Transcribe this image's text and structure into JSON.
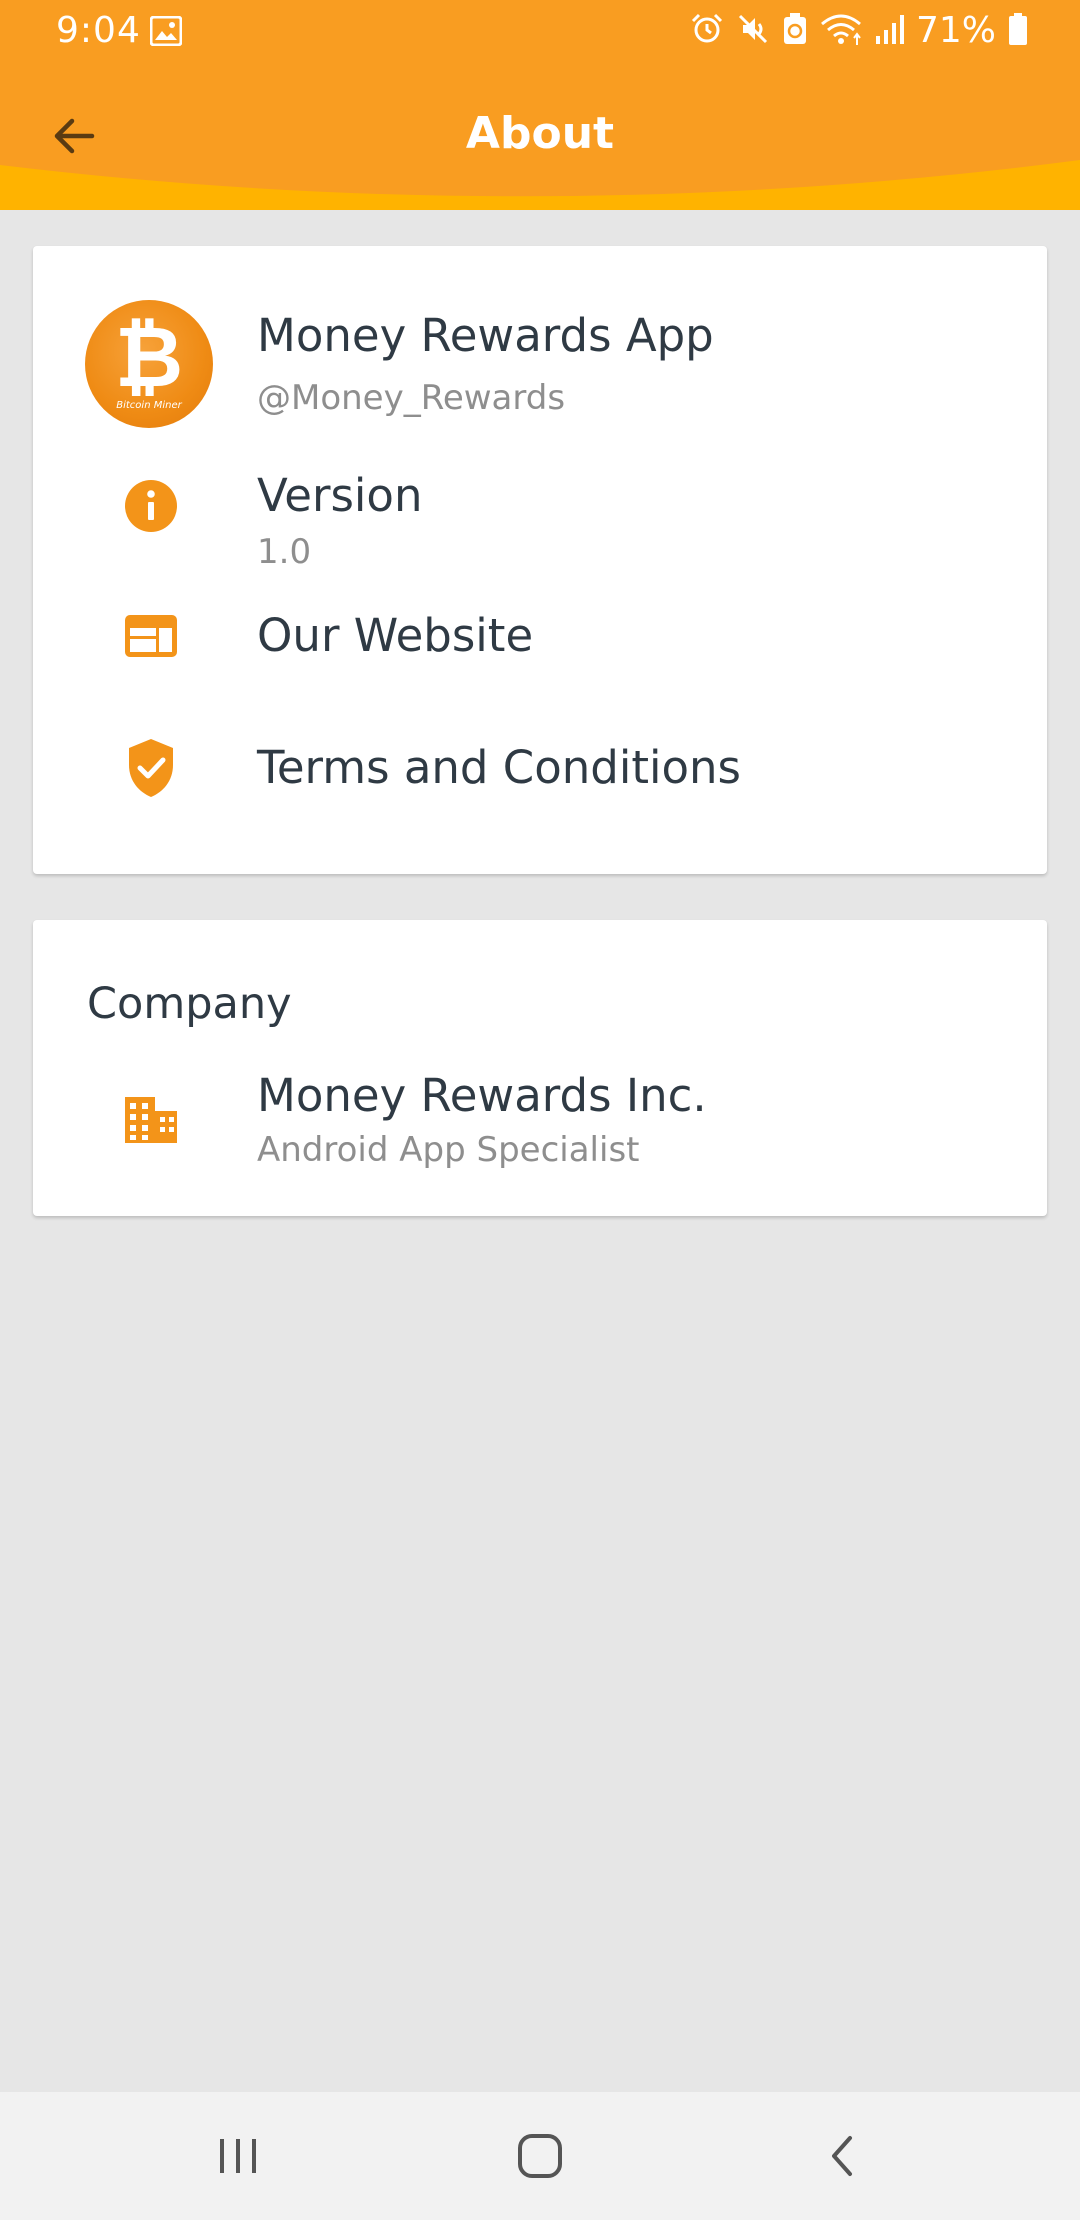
{
  "status_bar": {
    "time": "9:04",
    "battery_percent": "71%",
    "icons": [
      "gallery-icon",
      "alarm-icon",
      "mute-icon",
      "battery-saver-icon",
      "wifi-icon",
      "signal-icon",
      "battery-icon"
    ]
  },
  "app_bar": {
    "title": "About",
    "back_icon": "arrow-left-icon"
  },
  "about_card": {
    "app": {
      "name": "Money Rewards App",
      "handle": "@Money_Rewards",
      "logo_caption": "Bitcoin Miner"
    },
    "version": {
      "label": "Version",
      "value": "1.0",
      "icon": "info-icon"
    },
    "website": {
      "label": "Our Website",
      "icon": "web-icon"
    },
    "terms": {
      "label": "Terms and Conditions",
      "icon": "shield-check-icon"
    }
  },
  "company_card": {
    "heading": "Company",
    "name": "Money Rewards Inc.",
    "description": "Android App Specialist",
    "icon": "building-icon"
  },
  "nav_bar": {
    "buttons": [
      "recents-button",
      "home-button",
      "back-button"
    ]
  },
  "colors": {
    "primary": "#f99d21",
    "accent_curve": "#ffb300",
    "icon": "#f39419",
    "text_primary": "#2f3a44",
    "text_secondary": "#8e8e8e",
    "background": "#e6e6e6"
  }
}
